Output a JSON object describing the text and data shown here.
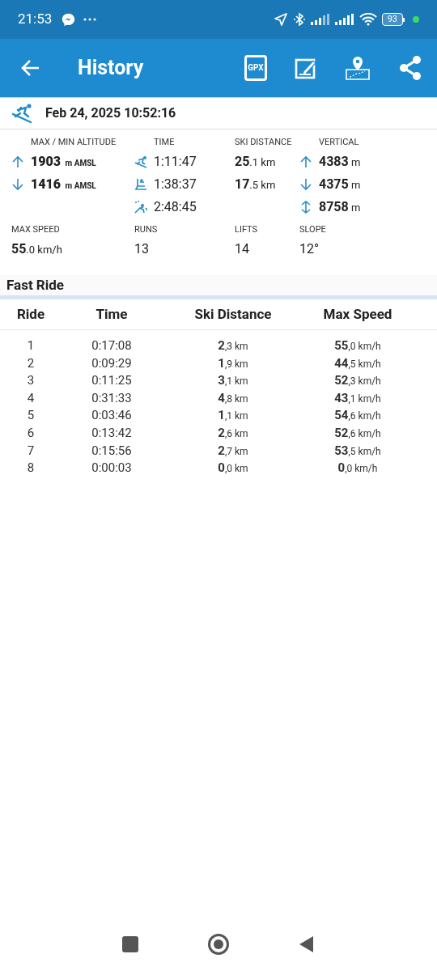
{
  "status_bar": {
    "time": "21:53",
    "battery": "93"
  },
  "app_bar": {
    "title": "History",
    "gpx_label": "GPX"
  },
  "session": {
    "date": "Feb 24, 2025 10:52:16"
  },
  "stats": [
    {
      "label": "MAX / MIN ALTITUDE",
      "lines": [
        {
          "text": "**1903** m AMSL",
          "kind": "altitude"
        },
        {
          "text": "**1416** m AMSL",
          "kind": "altitude"
        }
      ]
    },
    {
      "label": "TIME",
      "lines": [
        {
          "text": "1:11:47",
          "kind": "plain"
        },
        {
          "text": "1:38:37",
          "kind": "plain"
        },
        {
          "text": "2:48:45",
          "kind": "plain"
        }
      ]
    },
    {
      "label": "SKI DISTANCE",
      "lines": [
        {
          "text": "**25**.1 km",
          "kind": "measure"
        },
        {
          "text": "**17**.5 km",
          "kind": "measure"
        }
      ]
    },
    {
      "label": "VERTICAL",
      "lines": [
        {
          "text": "**4383** m",
          "kind": "measure"
        },
        {
          "text": "**4375** m",
          "kind": "measure"
        },
        {
          "text": "**8758** m",
          "kind": "measure"
        }
      ]
    },
    {
      "label": "MAX SPEED",
      "lines": [
        {
          "text": "**55**.0 km/h",
          "kind": "measure"
        }
      ]
    },
    {
      "label": "RUNS",
      "lines": [
        {
          "text": "13",
          "kind": "plain"
        }
      ]
    },
    {
      "label": "LIFTS",
      "lines": [
        {
          "text": "14",
          "kind": "plain"
        }
      ]
    },
    {
      "label": "SLOPE",
      "lines": [
        {
          "text": "12°",
          "kind": "plain"
        }
      ]
    }
  ],
  "fast_ride": {
    "title": "Fast Ride",
    "columns": [
      "Ride",
      "Time",
      "Ski Distance",
      "Max Speed"
    ],
    "rows": [
      [
        "1",
        "0:17:08",
        "**2**,3 km",
        "**55**,0 km/h"
      ],
      [
        "2",
        "0:09:29",
        "**1**,9 km",
        "**44**,5 km/h"
      ],
      [
        "3",
        "0:11:25",
        "**3**,1 km",
        "**52**,3 km/h"
      ],
      [
        "4",
        "0:31:33",
        "**4**,8 km",
        "**43**,1 km/h"
      ],
      [
        "5",
        "0:03:46",
        "**1**,1 km",
        "**54**,6 km/h"
      ],
      [
        "6",
        "0:13:42",
        "**2**,6 km",
        "**52**,6 km/h"
      ],
      [
        "7",
        "0:15:56",
        "**2**,7 km",
        "**53**,5 km/h"
      ],
      [
        "8",
        "0:00:03",
        "**0**,0 km",
        "**0**,0 km/h"
      ]
    ]
  }
}
